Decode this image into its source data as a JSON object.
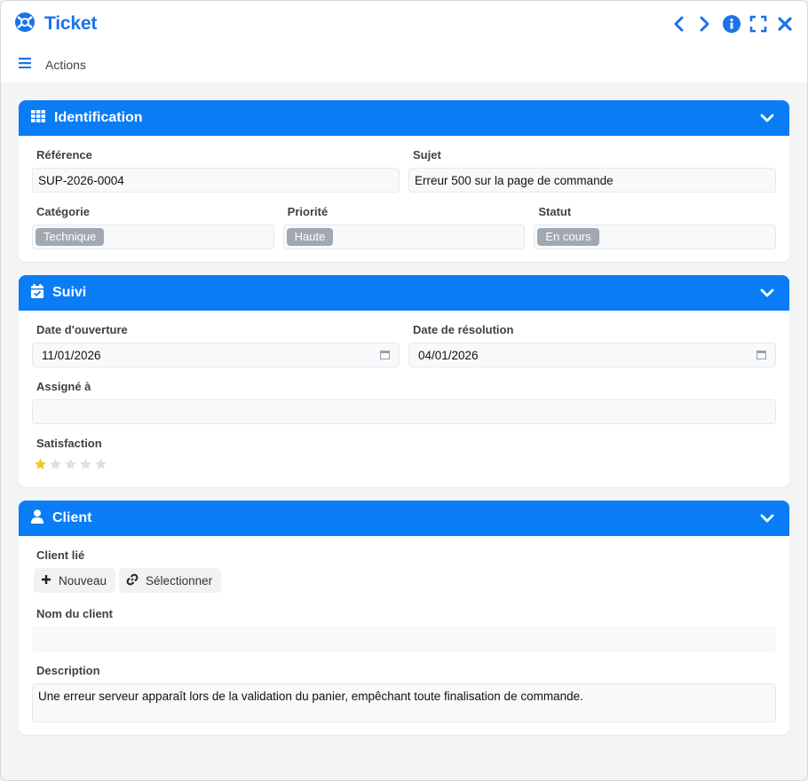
{
  "window": {
    "title": "Ticket",
    "accent": "#1a73e8"
  },
  "toolbar": {
    "actions_label": "Actions"
  },
  "sections": {
    "identification": {
      "title": "Identification",
      "reference_label": "Référence",
      "reference_value": "SUP-2026-0004",
      "subject_label": "Sujet",
      "subject_value": "Erreur 500 sur la page de commande",
      "category_label": "Catégorie",
      "category_value": "Technique",
      "priority_label": "Priorité",
      "priority_value": "Haute",
      "status_label": "Statut",
      "status_value": "En cours"
    },
    "suivi": {
      "title": "Suivi",
      "open_date_label": "Date d'ouverture",
      "open_date_value": "11/01/2026",
      "resolution_date_label": "Date de résolution",
      "resolution_date_value": "04/01/2026",
      "assigned_label": "Assigné à",
      "assigned_value": "",
      "satisfaction_label": "Satisfaction",
      "satisfaction_rating": 1,
      "satisfaction_max": 5
    },
    "client": {
      "title": "Client",
      "linked_client_label": "Client lié",
      "new_button": "Nouveau",
      "select_button": "Sélectionner",
      "client_name_label": "Nom du client",
      "client_name_value": "",
      "description_label": "Description",
      "description_value": "Une erreur serveur apparaît lors de la validation du panier, empêchant toute finalisation de commande."
    }
  },
  "icons": {
    "app": "lifebuoy-icon",
    "prev": "chevron-left-icon",
    "next": "chevron-right-icon",
    "info": "info-icon",
    "fullscreen": "expand-icon",
    "close": "close-icon",
    "menu": "hamburger-icon",
    "identification": "grid-icon",
    "suivi": "calendar-check-icon",
    "client": "user-icon"
  },
  "colors": {
    "header_blue": "#0a7cf5",
    "chip_gray": "#a0a8b2",
    "star_active": "#f5c518",
    "star_inactive": "#dcdfe3"
  }
}
